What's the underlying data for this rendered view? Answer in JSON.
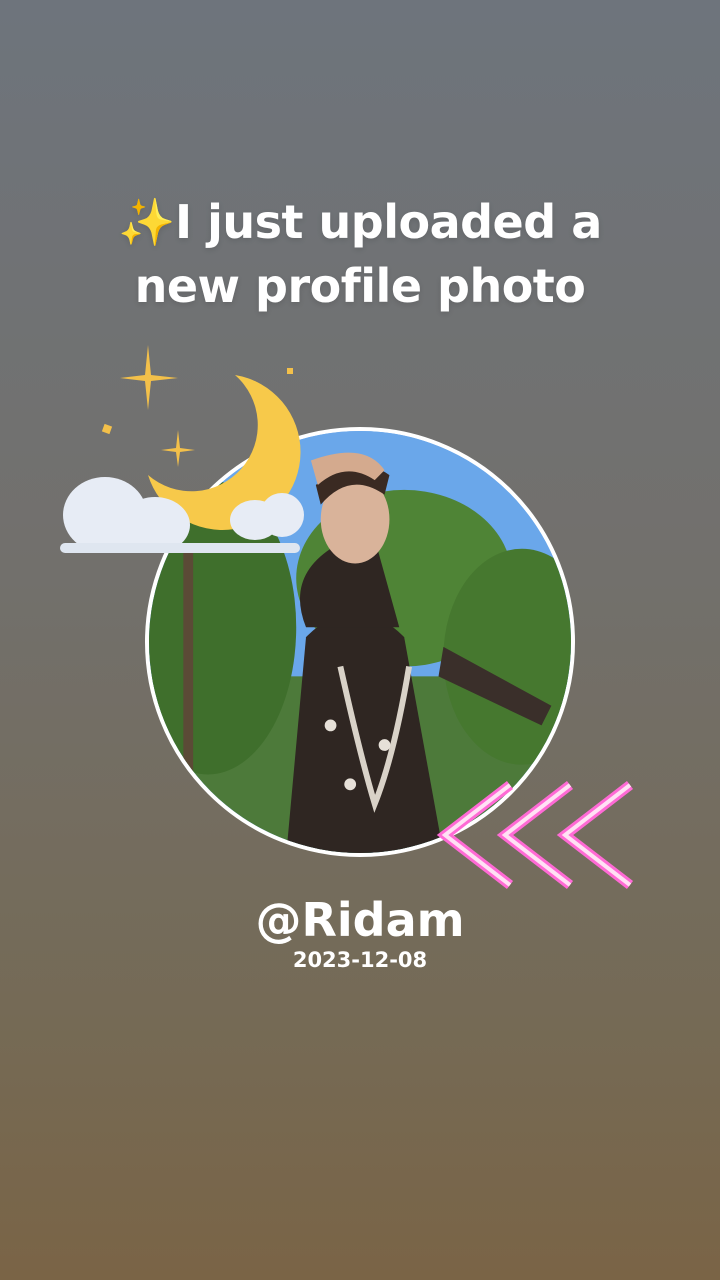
{
  "post": {
    "headline_emoji": "✨",
    "headline_text": "I just uploaded a new profile photo",
    "username": "@Ridam",
    "date": "2023-12-08"
  },
  "stickers": {
    "moon": "crescent-moon-with-clouds-icon",
    "arrows": "neon-chevron-arrows-icon"
  },
  "colors": {
    "background_top": "#6e747c",
    "background_bottom": "#7a6446",
    "text": "#ffffff",
    "moon": "#f7c94a",
    "neon_pink": "#ff6ad5"
  }
}
